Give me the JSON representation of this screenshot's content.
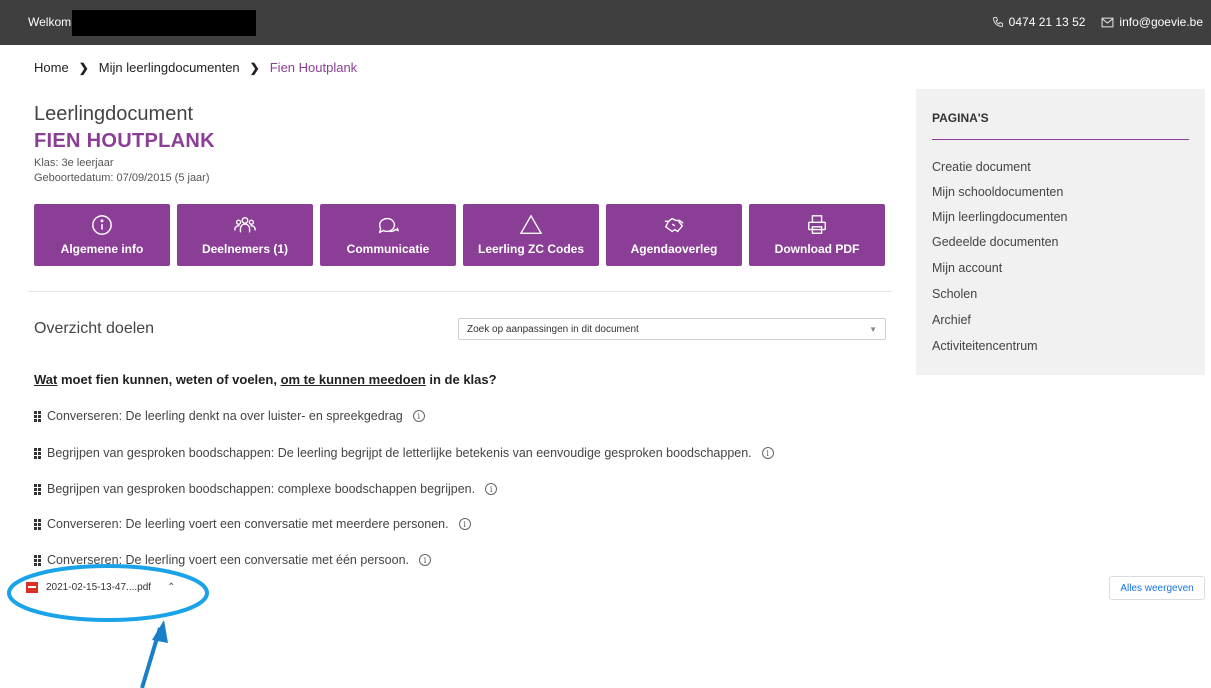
{
  "topbar": {
    "welcome": "Welkom",
    "phone": "0474 21 13 52",
    "email": "info@goevie.be"
  },
  "breadcrumb": {
    "home": "Home",
    "docs": "Mijn leerlingdocumenten",
    "current": "Fien Houtplank"
  },
  "header": {
    "doc_title": "Leerlingdocument",
    "student": "FIEN HOUTPLANK",
    "klas": "Klas: 3e leerjaar",
    "birth": "Geboortedatum: 07/09/2015 (5 jaar)"
  },
  "buttons": [
    {
      "label": "Algemene info",
      "icon": "info-icon"
    },
    {
      "label": "Deelnemers (1)",
      "icon": "people-icon"
    },
    {
      "label": "Communicatie",
      "icon": "chat-icon"
    },
    {
      "label": "Leerling ZC Codes",
      "icon": "triangle-icon"
    },
    {
      "label": "Agendaoverleg",
      "icon": "handshake-icon"
    },
    {
      "label": "Download PDF",
      "icon": "printer-icon"
    }
  ],
  "overview": {
    "title": "Overzicht doelen",
    "search_placeholder": "Zoek op aanpassingen in dit document"
  },
  "question": {
    "w1": "Wat",
    "t1": " moet fien kunnen, weten of voelen, ",
    "w2": "om te kunnen meedoen",
    "t2": " in de klas?"
  },
  "goals": [
    "Converseren: De leerling denkt na over luister- en spreekgedrag",
    "Begrijpen van gesproken boodschappen: De leerling begrijpt de letterlijke betekenis van eenvoudige gesproken boodschappen.",
    "Begrijpen van gesproken boodschappen: complexe boodschappen begrijpen.",
    "Converseren: De leerling voert een conversatie met meerdere personen.",
    "Converseren: De leerling voert een conversatie met één persoon."
  ],
  "info_glyph": "i",
  "sidebar": {
    "title": "PAGINA'S",
    "items": [
      "Creatie document",
      "Mijn schooldocumenten",
      "Mijn leerlingdocumenten",
      "Gedeelde documenten",
      "Mijn account",
      "Scholen",
      "Archief",
      "Activiteitencentrum"
    ]
  },
  "download": {
    "filename": "2021-02-15-13-47....pdf",
    "show_all": "Alles weergeven"
  },
  "colors": {
    "accent": "#8a3e95",
    "topbar": "#3f3f3f",
    "annotation": "#1aa3e8"
  }
}
